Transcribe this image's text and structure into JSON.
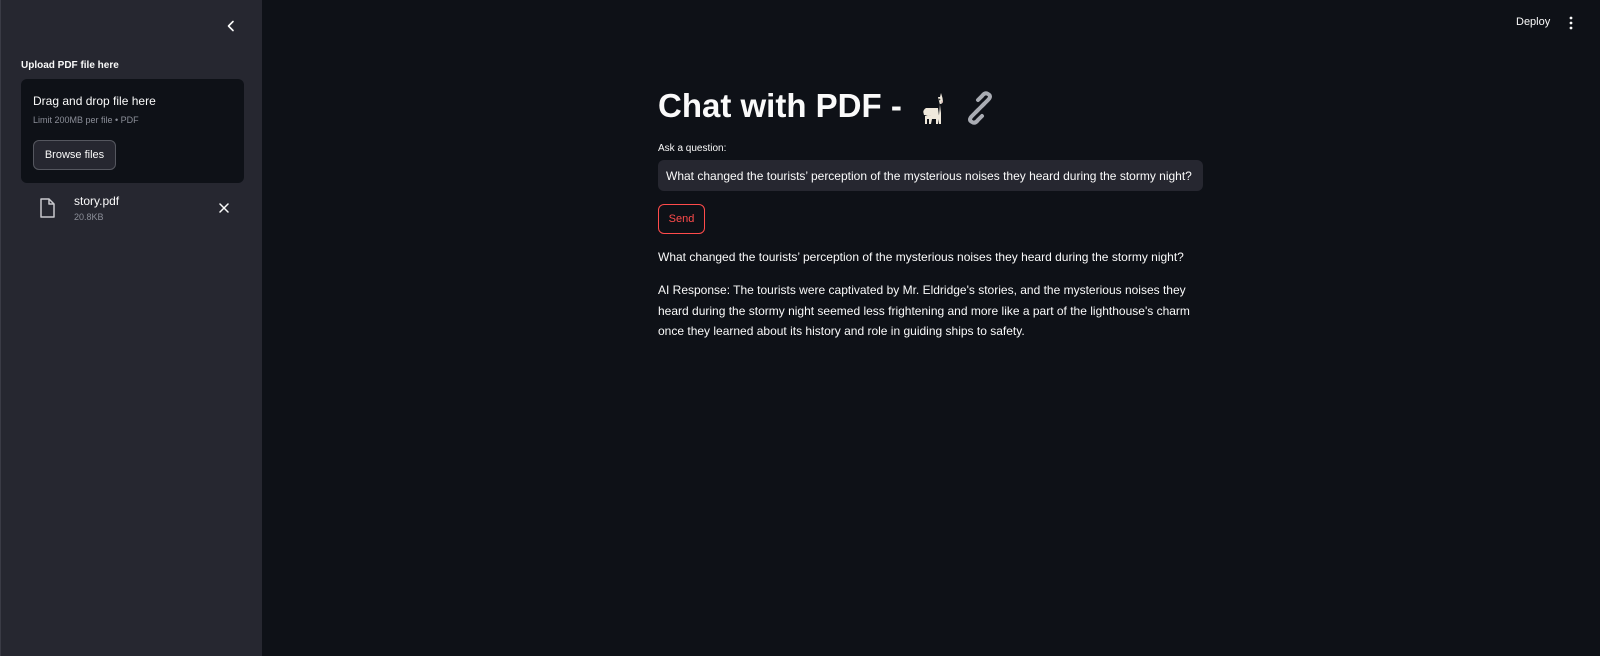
{
  "sidebar": {
    "upload_label": "Upload PDF file here",
    "dropzone": {
      "title": "Drag and drop file here",
      "limit": "Limit 200MB per file • PDF",
      "browse_label": "Browse files"
    },
    "file": {
      "name": "story.pdf",
      "size": "20.8KB"
    }
  },
  "header": {
    "deploy_label": "Deploy"
  },
  "main": {
    "title": "Chat with PDF -",
    "title_icons": [
      "llama-icon",
      "link-icon"
    ],
    "ask_label": "Ask a question:",
    "question_value": "What changed the tourists’ perception of the mysterious noises they heard during the stormy night?",
    "send_label": "Send",
    "asked_question": "What changed the tourists’ perception of the mysterious noises they heard during the stormy night?",
    "ai_response": "AI Response: The tourists were captivated by Mr. Eldridge's stories, and the mysterious noises they heard during the stormy night seemed less frightening and more like a part of the lighthouse's charm once they learned about its history and role in guiding ships to safety."
  },
  "colors": {
    "background": "#0e1117",
    "sidebar": "#262730",
    "accent": "#ff4b4b",
    "text": "#fafafa",
    "muted": "#8b8e98"
  }
}
